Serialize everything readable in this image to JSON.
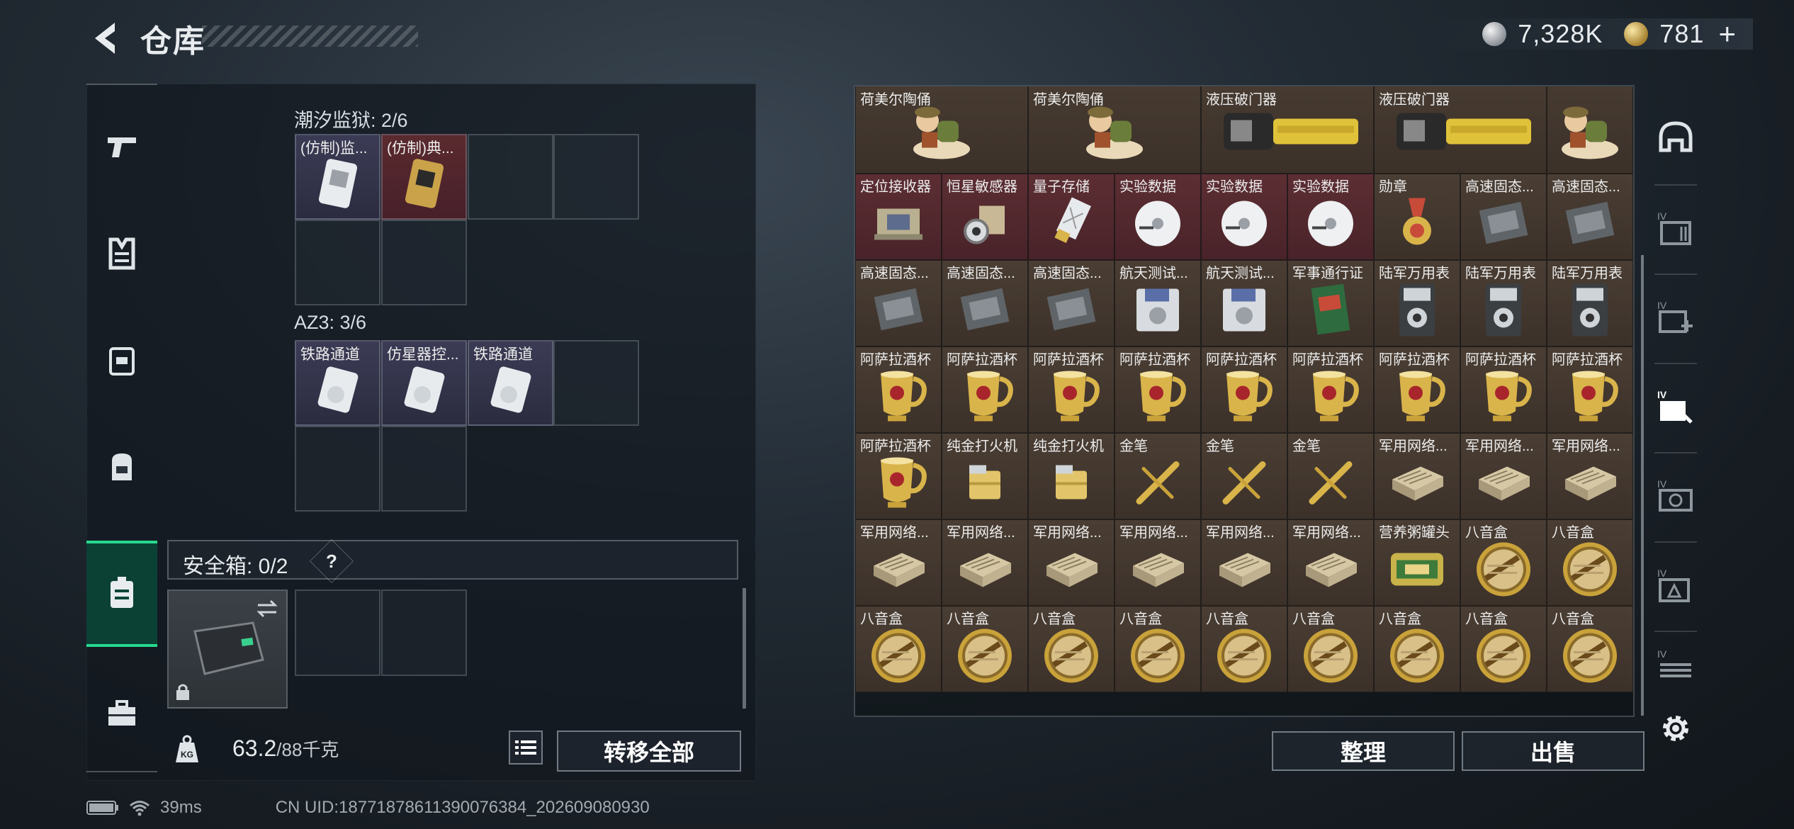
{
  "header": {
    "title": "仓库"
  },
  "currency": {
    "silver": "7,328K",
    "gold": "781",
    "plus": "+"
  },
  "left": {
    "slot_groups": [
      {
        "title": "潮汐监狱: 2/6",
        "items": [
          {
            "label": "(仿制)监...",
            "rarity": "purple",
            "icon": "keycard-icon"
          },
          {
            "label": "(仿制)典...",
            "rarity": "red",
            "icon": "keycard-icon"
          }
        ]
      },
      {
        "title": "AZ3: 3/6",
        "items": [
          {
            "label": "铁路通道",
            "rarity": "purple",
            "icon": "key-icon"
          },
          {
            "label": "仿星器控...",
            "rarity": "purple",
            "icon": "key-icon"
          },
          {
            "label": "铁路通道",
            "rarity": "purple",
            "icon": "key-icon"
          }
        ]
      }
    ],
    "safe_box_label": "安全箱: 0/2",
    "help": "?",
    "weight_value": "63.2",
    "weight_max": "/88千克",
    "kg_label": "KG",
    "transfer_all": "转移全部"
  },
  "stash": {
    "rows": [
      [
        {
          "l": "荷美尔陶俑",
          "i": "figurine-icon",
          "span": 2
        },
        {
          "l": "荷美尔陶俑",
          "i": "figurine-icon",
          "span": 2
        },
        {
          "l": "液压破门器",
          "i": "breacher-icon",
          "span": 2
        },
        {
          "l": "液压破门器",
          "i": "breacher-icon",
          "span": 2
        },
        {
          "l": "",
          "i": "figurine-icon",
          "span": 1
        }
      ],
      [
        {
          "l": "定位接收器",
          "i": "receiver-icon",
          "c": "red"
        },
        {
          "l": "恒星敏感器",
          "i": "sensor-icon",
          "c": "red"
        },
        {
          "l": "量子存储",
          "i": "usb-icon",
          "c": "red"
        },
        {
          "l": "实验数据",
          "i": "disc-icon",
          "c": "red"
        },
        {
          "l": "实验数据",
          "i": "disc-icon",
          "c": "red"
        },
        {
          "l": "实验数据",
          "i": "disc-icon",
          "c": "red"
        },
        {
          "l": "勋章",
          "i": "medal-icon"
        },
        {
          "l": "高速固态...",
          "i": "ssd-icon"
        },
        {
          "l": "高速固态...",
          "i": "ssd-icon"
        }
      ],
      [
        {
          "l": "高速固态...",
          "i": "ssd-icon"
        },
        {
          "l": "高速固态...",
          "i": "ssd-icon"
        },
        {
          "l": "高速固态...",
          "i": "ssd-icon"
        },
        {
          "l": "航天测试...",
          "i": "floppy-icon"
        },
        {
          "l": "航天测试...",
          "i": "floppy-icon"
        },
        {
          "l": "军事通行证",
          "i": "passport-icon"
        },
        {
          "l": "陆军万用表",
          "i": "meter-icon"
        },
        {
          "l": "陆军万用表",
          "i": "meter-icon"
        },
        {
          "l": "陆军万用表",
          "i": "meter-icon"
        }
      ],
      [
        {
          "l": "阿萨拉酒杯",
          "i": "cup-icon"
        },
        {
          "l": "阿萨拉酒杯",
          "i": "cup-icon"
        },
        {
          "l": "阿萨拉酒杯",
          "i": "cup-icon"
        },
        {
          "l": "阿萨拉酒杯",
          "i": "cup-icon"
        },
        {
          "l": "阿萨拉酒杯",
          "i": "cup-icon"
        },
        {
          "l": "阿萨拉酒杯",
          "i": "cup-icon"
        },
        {
          "l": "阿萨拉酒杯",
          "i": "cup-icon"
        },
        {
          "l": "阿萨拉酒杯",
          "i": "cup-icon"
        },
        {
          "l": "阿萨拉酒杯",
          "i": "cup-icon"
        }
      ],
      [
        {
          "l": "阿萨拉酒杯",
          "i": "cup-icon"
        },
        {
          "l": "纯金打火机",
          "i": "lighter-icon"
        },
        {
          "l": "纯金打火机",
          "i": "lighter-icon"
        },
        {
          "l": "金笔",
          "i": "pen-icon"
        },
        {
          "l": "金笔",
          "i": "pen-icon"
        },
        {
          "l": "金笔",
          "i": "pen-icon"
        },
        {
          "l": "军用网络...",
          "i": "router-icon"
        },
        {
          "l": "军用网络...",
          "i": "router-icon"
        },
        {
          "l": "军用网络...",
          "i": "router-icon"
        }
      ],
      [
        {
          "l": "军用网络...",
          "i": "router-icon"
        },
        {
          "l": "军用网络...",
          "i": "router-icon"
        },
        {
          "l": "军用网络...",
          "i": "router-icon"
        },
        {
          "l": "军用网络...",
          "i": "router-icon"
        },
        {
          "l": "军用网络...",
          "i": "router-icon"
        },
        {
          "l": "军用网络...",
          "i": "router-icon"
        },
        {
          "l": "营养粥罐头",
          "i": "can-icon"
        },
        {
          "l": "八音盒",
          "i": "musicbox-icon"
        },
        {
          "l": "八音盒",
          "i": "musicbox-icon"
        }
      ],
      [
        {
          "l": "八音盒",
          "i": "musicbox-icon"
        },
        {
          "l": "八音盒",
          "i": "musicbox-icon"
        },
        {
          "l": "八音盒",
          "i": "musicbox-icon"
        },
        {
          "l": "八音盒",
          "i": "musicbox-icon"
        },
        {
          "l": "八音盒",
          "i": "musicbox-icon"
        },
        {
          "l": "八音盒",
          "i": "musicbox-icon"
        },
        {
          "l": "八音盒",
          "i": "musicbox-icon"
        },
        {
          "l": "八音盒",
          "i": "musicbox-icon"
        },
        {
          "l": "八音盒",
          "i": "musicbox-icon"
        }
      ]
    ],
    "sort_button": "整理",
    "sell_button": "出售"
  },
  "status": {
    "ping": "39ms",
    "uid": "CN UID:18771878611390076384_202609080930"
  }
}
